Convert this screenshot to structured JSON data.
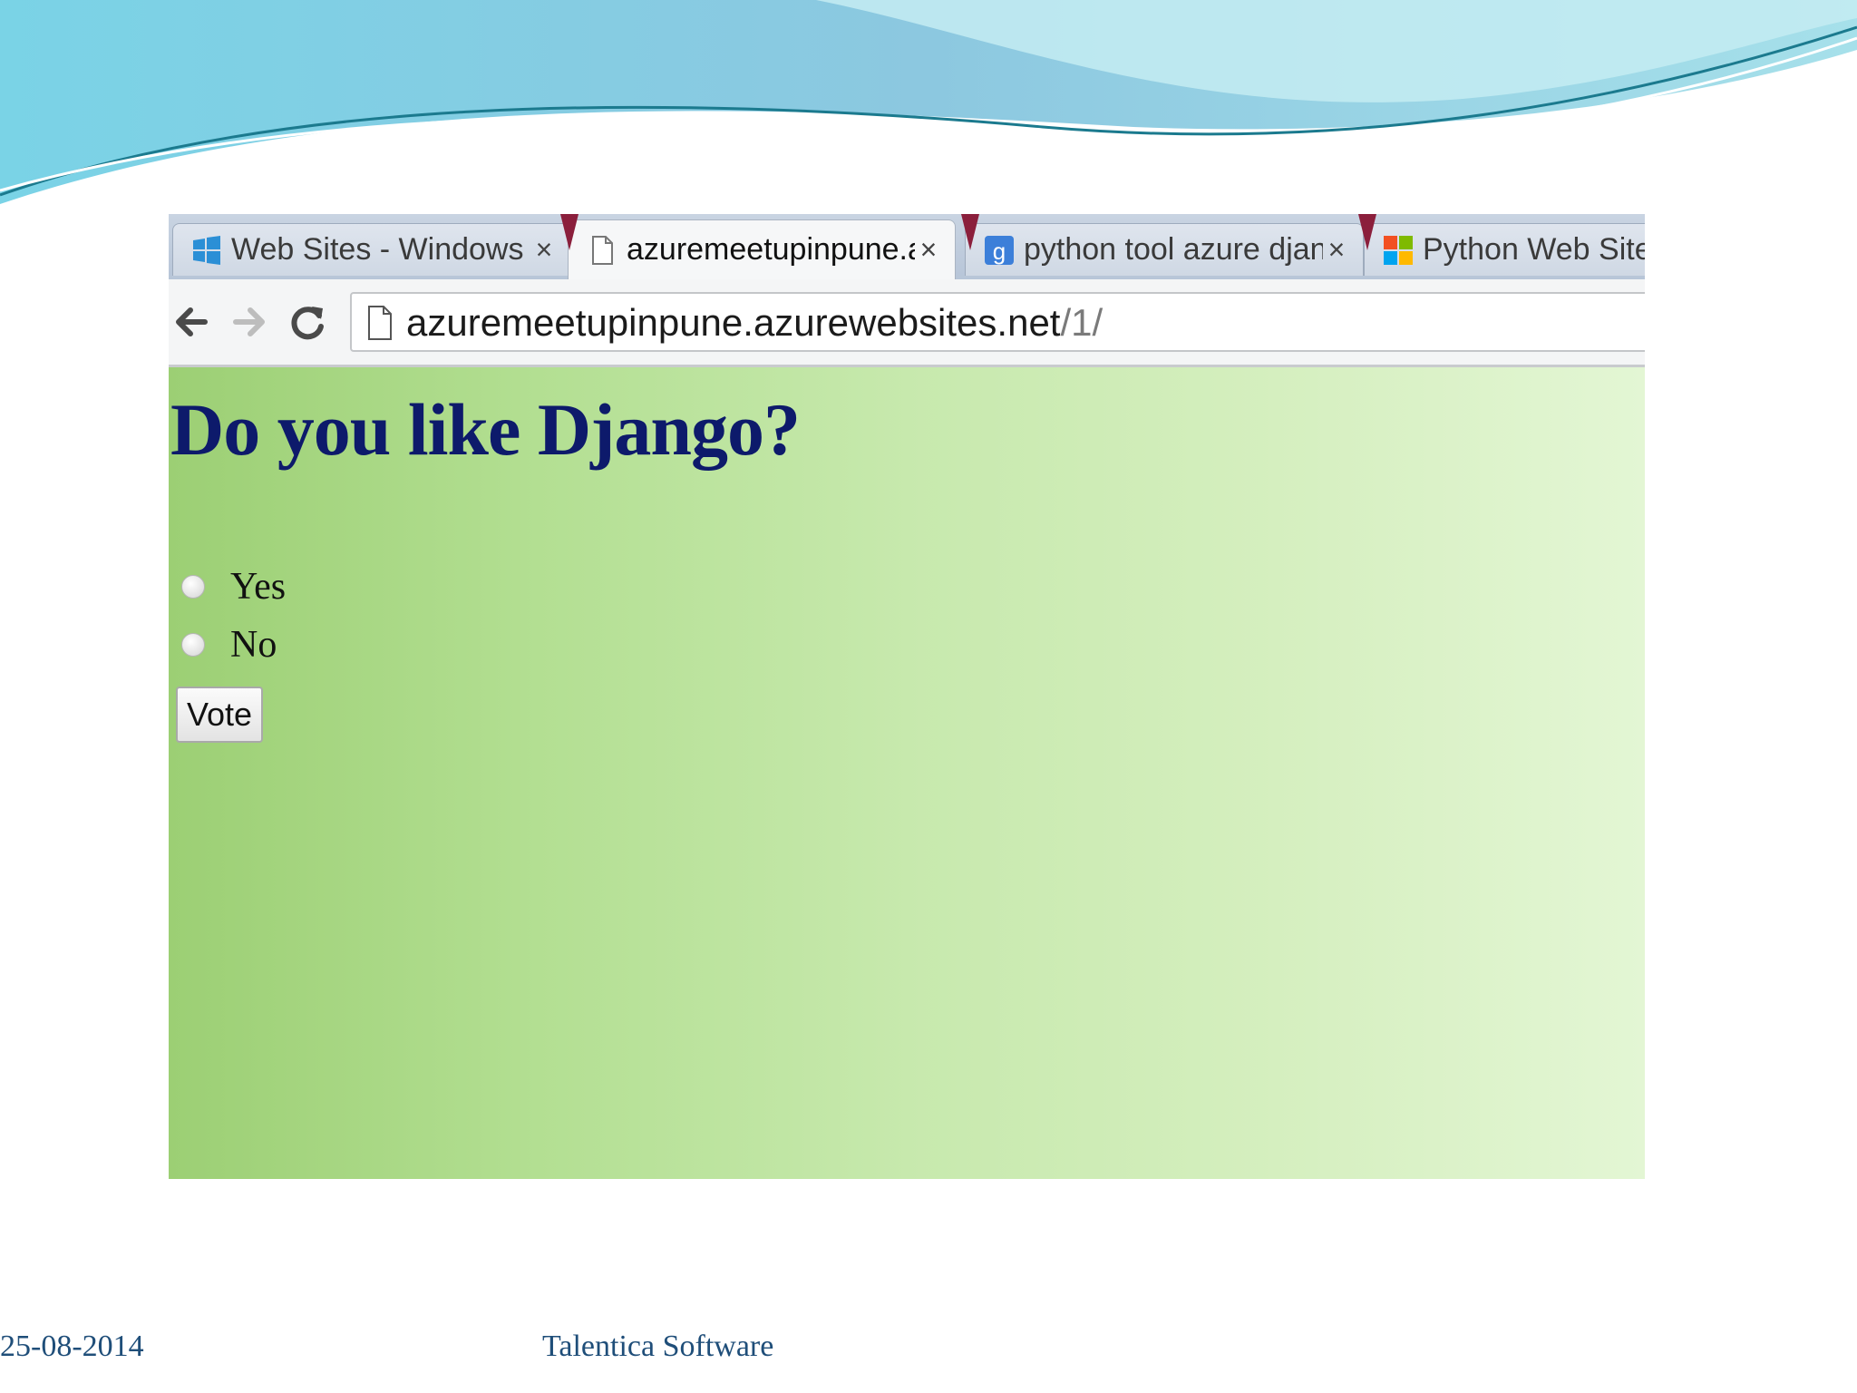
{
  "browser": {
    "tabs": [
      {
        "title": "Web Sites - Windows Azur",
        "icon": "windows-icon",
        "active": false
      },
      {
        "title": "azuremeetupinpune.azure",
        "icon": "page-icon",
        "active": true
      },
      {
        "title": "python tool azure django",
        "icon": "google-icon",
        "active": false
      },
      {
        "title": "Python Web Sites w",
        "icon": "microsoft-icon",
        "active": false
      }
    ],
    "tab_close_glyph": "×",
    "url_host": "azuremeetupinpune.azurewebsites.net",
    "url_path": "/1/"
  },
  "page": {
    "question": "Do you like Django?",
    "choices": [
      {
        "label": "Yes"
      },
      {
        "label": "No"
      }
    ],
    "vote_button": "Vote"
  },
  "slide": {
    "footer_date": "25-08-2014",
    "footer_company": "Talentica Software"
  }
}
